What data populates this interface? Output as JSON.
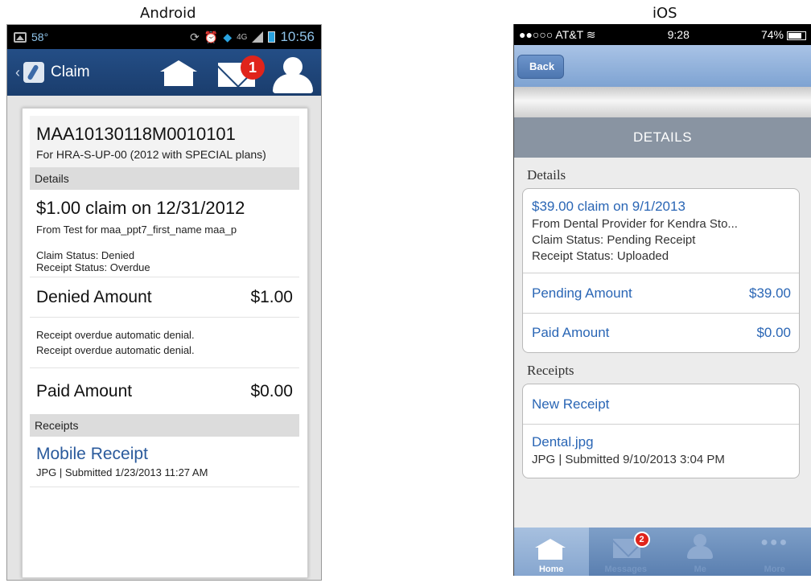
{
  "labels": {
    "android": "Android",
    "ios": "iOS"
  },
  "android": {
    "status": {
      "temp": "58°",
      "network": "4G",
      "time": "10:56"
    },
    "appbar": {
      "back": "‹",
      "title": "Claim",
      "badge": "1"
    },
    "claim_id": "MAA10130118M0010101",
    "plan": "For HRA-S-UP-00 (2012 with SPECIAL plans)",
    "details_header": "Details",
    "summary": {
      "title": "$1.00 claim on 12/31/2012",
      "from": "From Test  for maa_ppt7_first_name maa_p",
      "claim_status": "Claim Status: Denied",
      "receipt_status": "Receipt Status: Overdue"
    },
    "denied": {
      "label": "Denied Amount",
      "value": "$1.00"
    },
    "notes": [
      "Receipt overdue automatic denial.",
      "Receipt overdue automatic denial."
    ],
    "paid": {
      "label": "Paid Amount",
      "value": "$0.00"
    },
    "receipts_header": "Receipts",
    "receipt": {
      "name": "Mobile Receipt",
      "meta": "JPG | Submitted 1/23/2013 11:27 AM"
    }
  },
  "ios": {
    "status": {
      "carrier": "●●○○○ AT&T",
      "time": "9:28",
      "battery": "74%"
    },
    "back_label": "Back",
    "title": "DETAILS",
    "details_header": "Details",
    "claim": {
      "title": "$39.00 claim on 9/1/2013",
      "from": "From Dental Provider for Kendra Sto...",
      "claim_status": "Claim Status: Pending Receipt",
      "receipt_status": "Receipt Status: Uploaded"
    },
    "pending": {
      "label": "Pending Amount",
      "value": "$39.00"
    },
    "paid": {
      "label": "Paid Amount",
      "value": "$0.00"
    },
    "receipts_header": "Receipts",
    "new_receipt": "New Receipt",
    "file": {
      "name": "Dental.jpg",
      "meta": "JPG | Submitted 9/10/2013 3:04 PM"
    },
    "tabs": [
      {
        "label": "Home"
      },
      {
        "label": "Messages",
        "badge": "2"
      },
      {
        "label": "Me"
      },
      {
        "label": "More"
      }
    ]
  },
  "colors": {
    "android_bar": "#1f4678",
    "ios_nav": "#8fb0db",
    "link": "#2a5a9c",
    "badge": "#e0241b"
  }
}
